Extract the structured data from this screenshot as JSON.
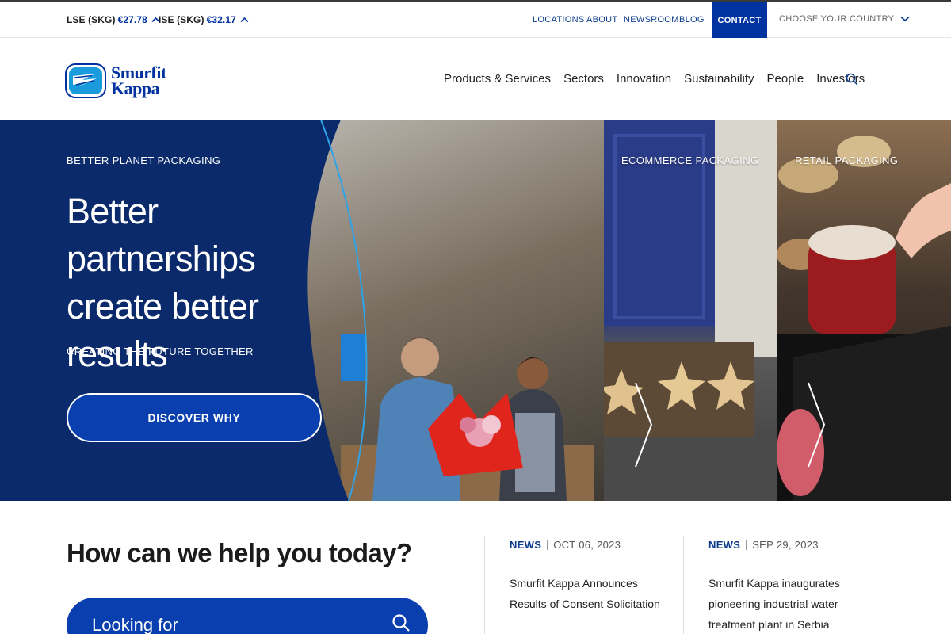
{
  "utility": {
    "tickers": [
      {
        "label": "LSE (SKG)",
        "price": "€27.78"
      },
      {
        "label": "ISE (SKG)",
        "price": "€32.17"
      }
    ],
    "links": {
      "locations": "LOCATIONS",
      "about": "ABOUT",
      "newsroom": "NEWSROOM",
      "blog": "BLOG",
      "contact": "CONTACT",
      "country": "CHOOSE YOUR COUNTRY"
    }
  },
  "header": {
    "logo_line1": "Smurfit",
    "logo_line2": "Kappa",
    "nav": [
      "Products & Services",
      "Sectors",
      "Innovation",
      "Sustainability",
      "People",
      "Investors"
    ]
  },
  "hero": {
    "eyebrow": "BETTER PLANET PACKAGING",
    "title": "Better partnerships create better results",
    "subtitle": "CREATING THE FUTURE TOGETHER",
    "cta": "DISCOVER WHY",
    "panels": [
      "ECOMMERCE PACKAGING",
      "RETAIL PACKAGING"
    ]
  },
  "help": {
    "title": "How can we help you today?",
    "search_placeholder": "Looking for"
  },
  "news": [
    {
      "tag": "NEWS",
      "date": "OCT 06, 2023",
      "headline": "Smurfit Kappa Announces Results of Consent Solicitation"
    },
    {
      "tag": "NEWS",
      "date": "SEP 29, 2023",
      "headline": "Smurfit Kappa inaugurates pioneering industrial water treatment plant in Serbia"
    }
  ],
  "colors": {
    "brand_blue": "#0033a0",
    "hero_navy": "#0a2a6b",
    "cta_blue": "#0a3fb0"
  }
}
